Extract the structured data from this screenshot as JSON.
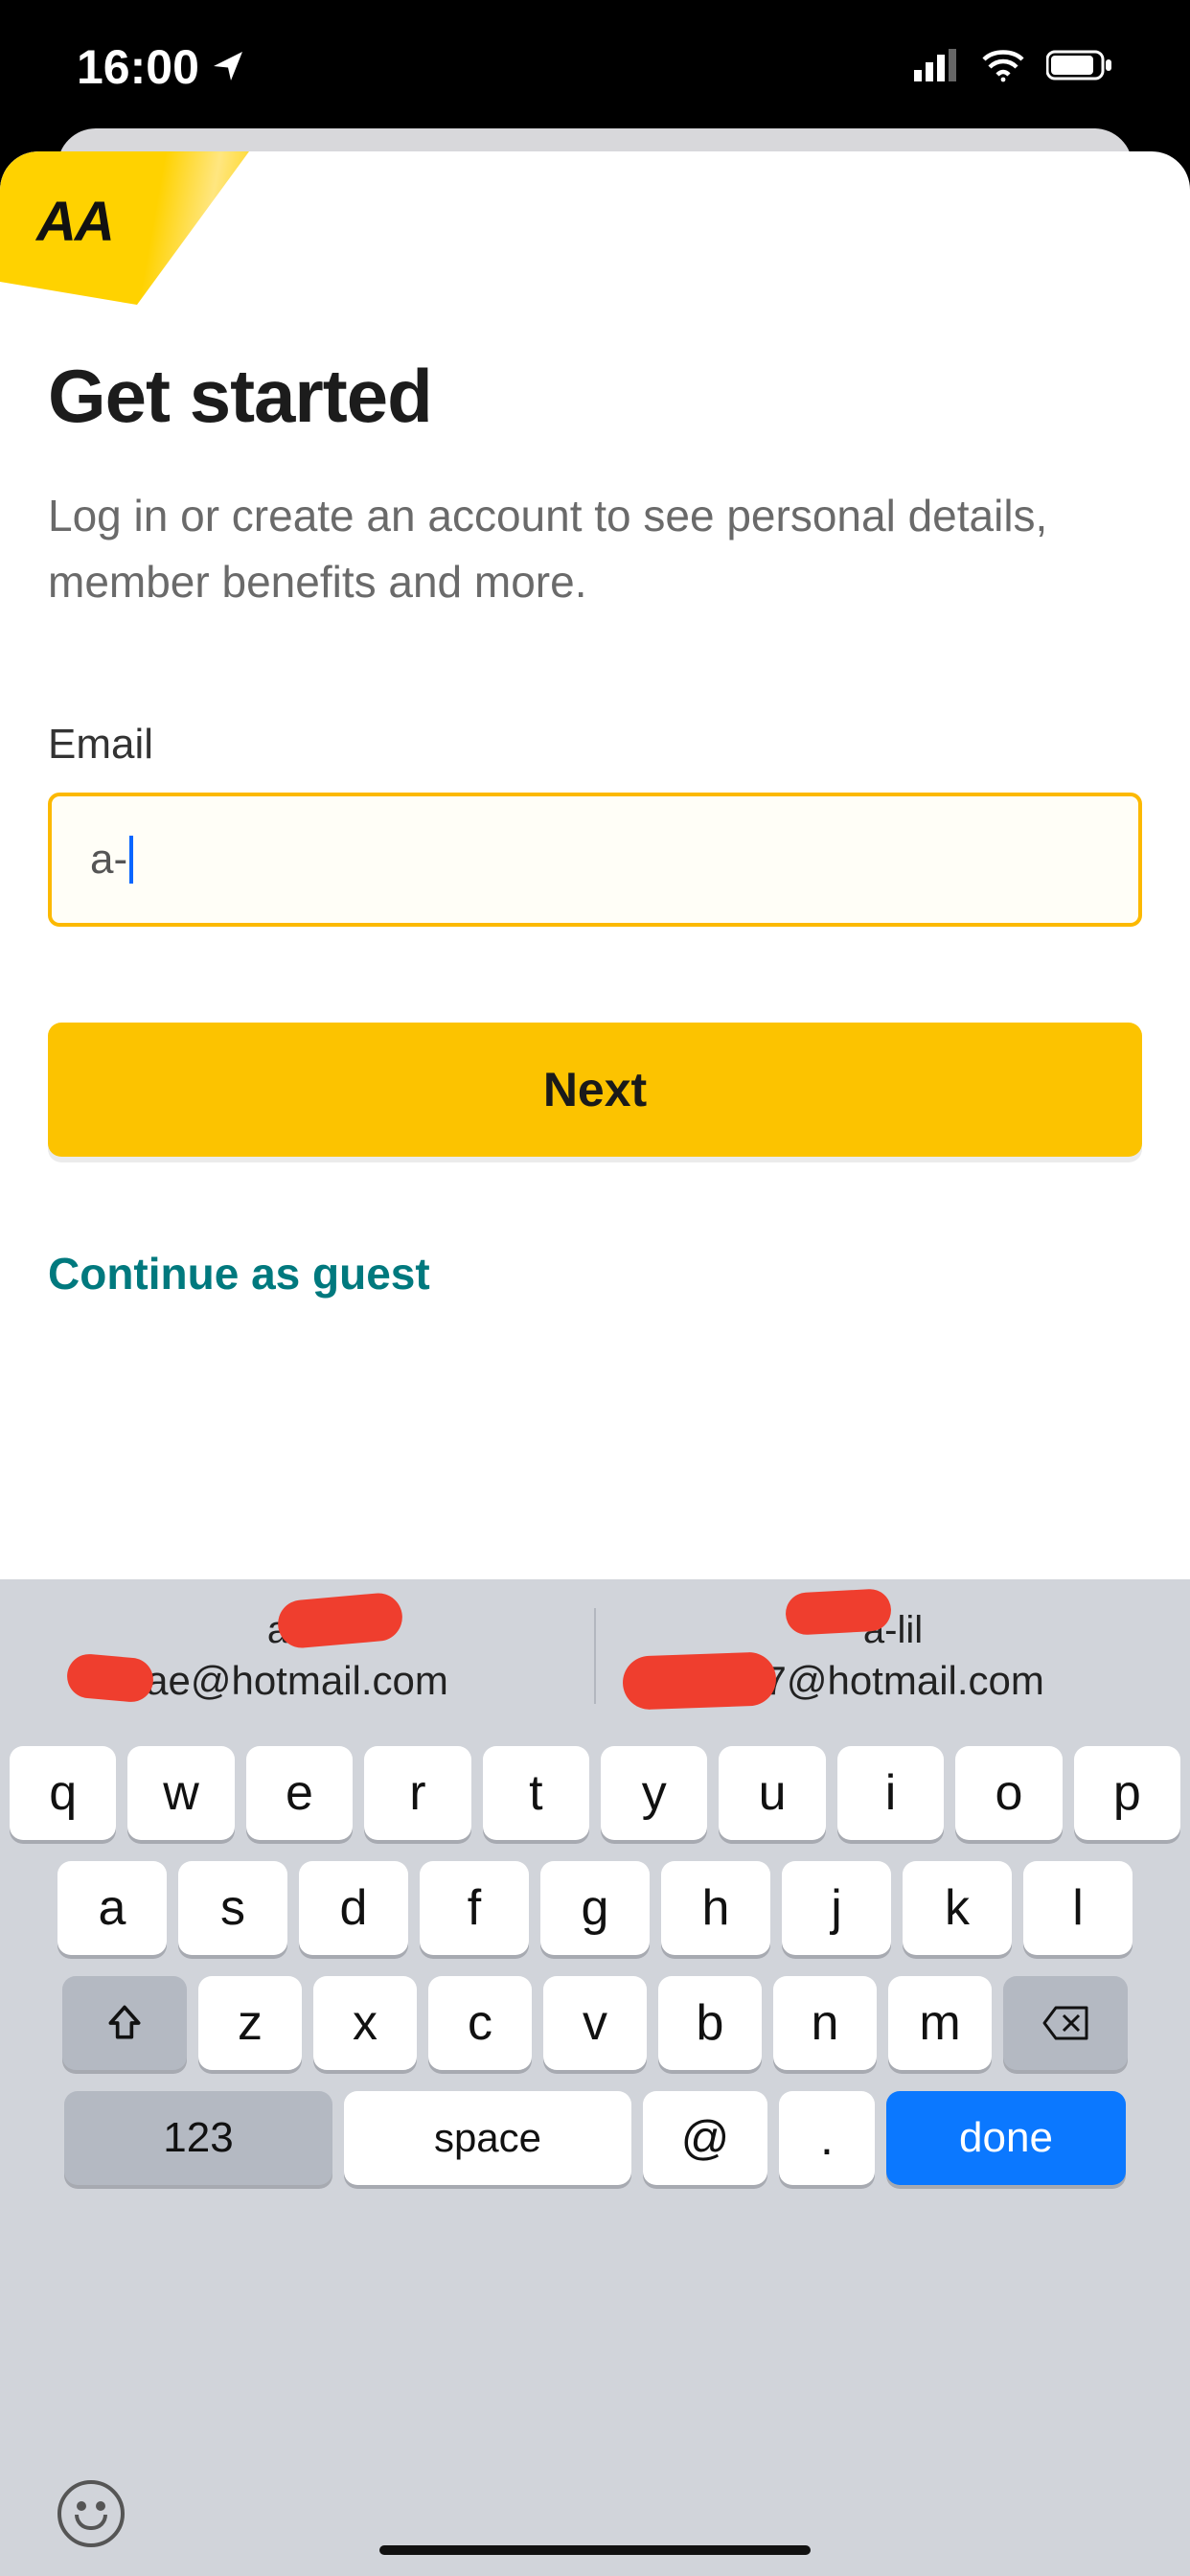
{
  "status": {
    "time": "16:00"
  },
  "logo": {
    "text": "AA"
  },
  "page": {
    "title": "Get started",
    "subtitle": "Log in or create an account to see personal details, member benefits and more.",
    "email_label": "Email",
    "email_value": "a-",
    "next_label": "Next",
    "guest_label": "Continue as guest"
  },
  "suggestions": {
    "left": {
      "line1": "a-lil",
      "line2": "ae@hotmail.com"
    },
    "right": {
      "line1": "a-lil",
      "line2": "67@hotmail.com"
    }
  },
  "keyboard": {
    "row1": [
      "q",
      "w",
      "e",
      "r",
      "t",
      "y",
      "u",
      "i",
      "o",
      "p"
    ],
    "row2": [
      "a",
      "s",
      "d",
      "f",
      "g",
      "h",
      "j",
      "k",
      "l"
    ],
    "row3": [
      "z",
      "x",
      "c",
      "v",
      "b",
      "n",
      "m"
    ],
    "numbers": "123",
    "space": "space",
    "at": "@",
    "dot": ".",
    "done": "done"
  }
}
